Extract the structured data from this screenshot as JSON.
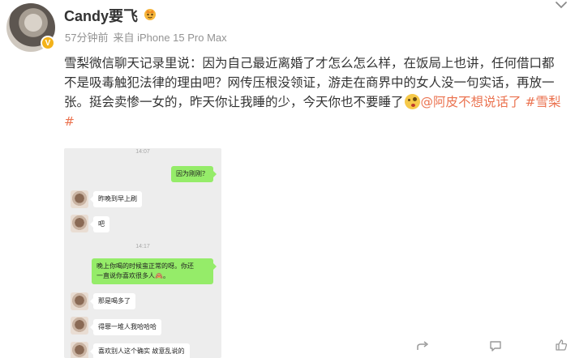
{
  "author": {
    "name": "Candy要飞",
    "badge_icon": "crown-icon",
    "verified_letter": "V"
  },
  "meta": {
    "time": "57分钟前",
    "source": "来自 iPhone 15 Pro Max"
  },
  "post": {
    "text": "雪梨微信聊天记录里说：因为自己最近离婚了才怎么怎么样，在饭局上也讲，任何借口都不是吸毒触犯法律的理由吧？网传压根没领证，游走在商界中的女人没一句实话，再放一张。挺会卖惨一女的，昨天你让我睡的少，今天你也不要睡了",
    "mention": "@阿皮不想说话了",
    "hashtag": "#雪梨#"
  },
  "chat": {
    "timestamp_1": "14:07",
    "msg_1": "因为刚刚？",
    "msg_2": "昨晚到早上刷",
    "msg_3": "吧",
    "timestamp_2": "14:17",
    "msg_4_line1": "晚上你喝的时候蛮正常的呀。你还",
    "msg_4_line2": "一直说你喜欢很多人🙈。",
    "msg_5": "那是喝多了",
    "msg_6": "得罪一堆人我哈哈哈",
    "msg_7": "喜欢别人这个确实 故意乱说的"
  },
  "actions": {
    "forward_icon": "share-icon",
    "comment_icon": "comment-icon",
    "like_icon": "thumbs-up-icon"
  },
  "colors": {
    "link": "#eb7350",
    "bubble_green": "#95ec69",
    "meta_gray": "#939393"
  }
}
